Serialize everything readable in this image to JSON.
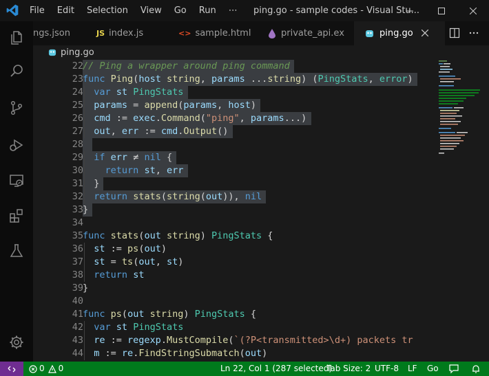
{
  "window": {
    "title": "ping.go - sample codes - Visual Stu...",
    "menu": [
      "File",
      "Edit",
      "Selection",
      "View",
      "Go",
      "Run",
      "⋯"
    ]
  },
  "tabs": [
    {
      "label": "ngs.json",
      "icon": "json-file-icon",
      "glyph": ""
    },
    {
      "label": "index.js",
      "icon": "js-file-icon",
      "glyph": "JS"
    },
    {
      "label": "sample.html",
      "icon": "html-file-icon",
      "glyph": "<>"
    },
    {
      "label": "private_api.ex",
      "icon": "elixir-file-icon",
      "glyph": "💧"
    },
    {
      "label": "ping.go",
      "icon": "go-file-icon",
      "glyph": "▣",
      "active": true
    }
  ],
  "breadcrumb": {
    "file": "ping.go"
  },
  "editor": {
    "lines": [
      {
        "n": "22",
        "text": "// Ping a wrapper around ping command"
      },
      {
        "n": "23",
        "text": "func Ping(host string, params ...string) (PingStats, error)"
      },
      {
        "n": "24",
        "text": "  var st PingStats"
      },
      {
        "n": "25",
        "text": "  params = append(params, host)"
      },
      {
        "n": "26",
        "text": "  cmd := exec.Command(\"ping\", params...)"
      },
      {
        "n": "27",
        "text": "  out, err := cmd.Output()"
      },
      {
        "n": "28",
        "text": ""
      },
      {
        "n": "29",
        "text": "  if err ≠ nil {"
      },
      {
        "n": "30",
        "text": "    return st, err"
      },
      {
        "n": "31",
        "text": "  }"
      },
      {
        "n": "32",
        "text": "  return stats(string(out)), nil"
      },
      {
        "n": "33",
        "text": "}"
      },
      {
        "n": "34",
        "text": ""
      },
      {
        "n": "35",
        "text": "func stats(out string) PingStats {"
      },
      {
        "n": "36",
        "text": "  st := ps(out)"
      },
      {
        "n": "37",
        "text": "  st = ts(out, st)"
      },
      {
        "n": "38",
        "text": "  return st"
      },
      {
        "n": "39",
        "text": "}"
      },
      {
        "n": "40",
        "text": ""
      },
      {
        "n": "41",
        "text": "func ps(out string) PingStats {"
      },
      {
        "n": "42",
        "text": "  var st PingStats"
      },
      {
        "n": "43",
        "text": "  re := regexp.MustCompile(`(?P<transmitted>\\d+) packets tr"
      },
      {
        "n": "44",
        "text": "  m := re.FindStringSubmatch(out)"
      }
    ]
  },
  "statusbar": {
    "errors": "0",
    "warnings": "0",
    "cursor": "Ln 22, Col 1 (287 selected)",
    "tab_size": "Tab Size: 2",
    "encoding": "UTF-8",
    "eol": "LF",
    "language": "Go"
  },
  "colors": {
    "statusbar": "#007a1c",
    "remote": "#6f2d91",
    "keyword": "#569cd6",
    "function": "#dcdcaa",
    "string": "#ce9178",
    "comment": "#6a9955"
  }
}
